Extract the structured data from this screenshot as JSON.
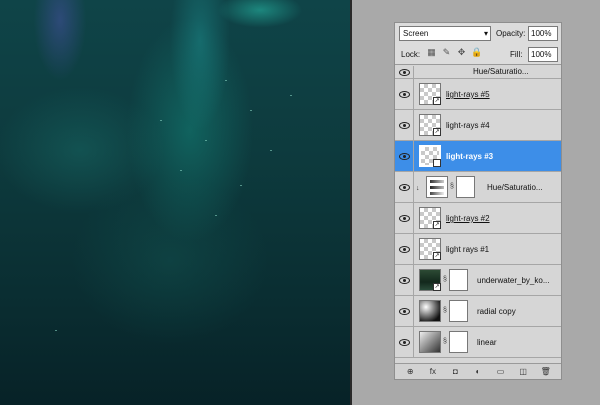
{
  "panel": {
    "blend_mode": "Screen",
    "opacity_label": "Opacity:",
    "opacity_value": "100%",
    "lock_label": "Lock:",
    "fill_label": "Fill:",
    "fill_value": "100%"
  },
  "layers": [
    {
      "name": "Hue/Saturatio...",
      "type": "adjustment",
      "clipped": true
    },
    {
      "name": "light-rays #5",
      "type": "transparent",
      "underlined": true
    },
    {
      "name": "light-rays #4",
      "type": "transparent"
    },
    {
      "name": "light-rays #3",
      "type": "transparent",
      "selected": true
    },
    {
      "name": "Hue/Saturatio...",
      "type": "adjustment",
      "clipped": true
    },
    {
      "name": "light-rays #2",
      "type": "transparent",
      "underlined": true
    },
    {
      "name": "light rays #1",
      "type": "transparent"
    },
    {
      "name": "underwater_by_ko...",
      "type": "photo-with-mask"
    },
    {
      "name": "radial copy",
      "type": "gradient-with-mask"
    },
    {
      "name": "linear",
      "type": "gradient-with-mask"
    }
  ],
  "colors": {
    "selected_row": "#3d8ee8",
    "panel_bg": "#d6d6d6",
    "canvas_dark": "#0a2d31",
    "canvas_teal": "#1a8a7f"
  },
  "bottom_icons": [
    "link-icon",
    "fx-icon",
    "mask-icon",
    "adjustment-icon",
    "group-icon",
    "new-layer-icon",
    "trash-icon"
  ],
  "bottom_glyphs": [
    "⊕",
    "fx",
    "◘",
    "◐",
    "▭",
    "◫",
    "🗑"
  ]
}
